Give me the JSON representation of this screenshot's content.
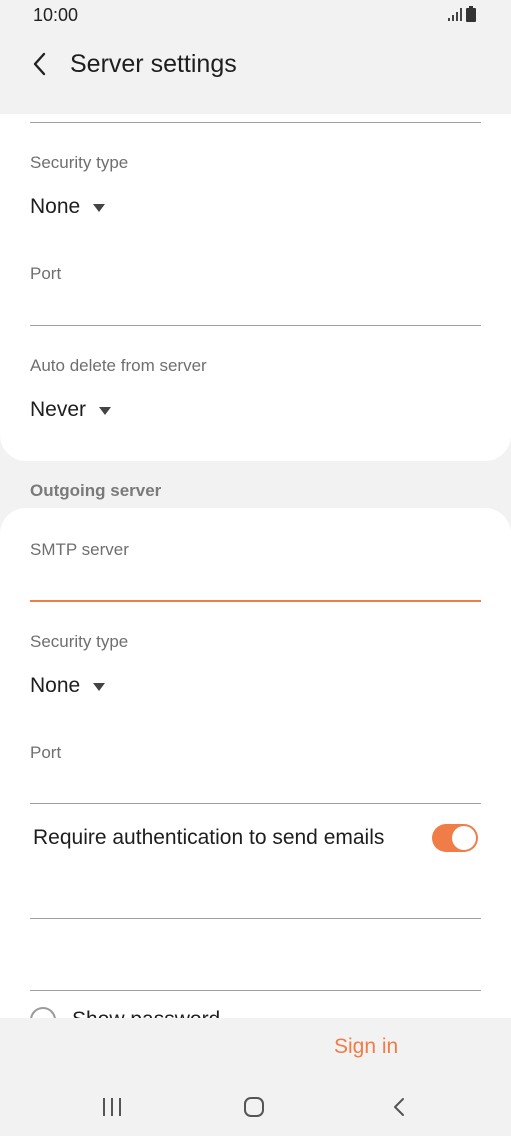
{
  "status_bar": {
    "time": "10:00"
  },
  "header": {
    "title": "Server settings"
  },
  "incoming": {
    "security_type_label": "Security type",
    "security_type_value": "None",
    "port_label": "Port",
    "auto_delete_label": "Auto delete from server",
    "auto_delete_value": "Never"
  },
  "outgoing": {
    "section_title": "Outgoing server",
    "smtp_label": "SMTP server",
    "security_type_label": "Security type",
    "security_type_value": "None",
    "port_label": "Port",
    "require_auth_label": "Require authentication to send emails",
    "require_auth_on": true,
    "show_password_label": "Show password"
  },
  "footer": {
    "signin_label": "Sign in"
  },
  "colors": {
    "accent": "#f07c48",
    "background": "#f2f2f2",
    "card": "#ffffff"
  },
  "icons": {
    "back": "back-arrow-icon",
    "signal": "signal-icon",
    "battery": "battery-icon",
    "dropdown": "caret-down-icon",
    "recents": "recents-icon",
    "home": "home-icon",
    "nav_back": "nav-back-icon"
  }
}
